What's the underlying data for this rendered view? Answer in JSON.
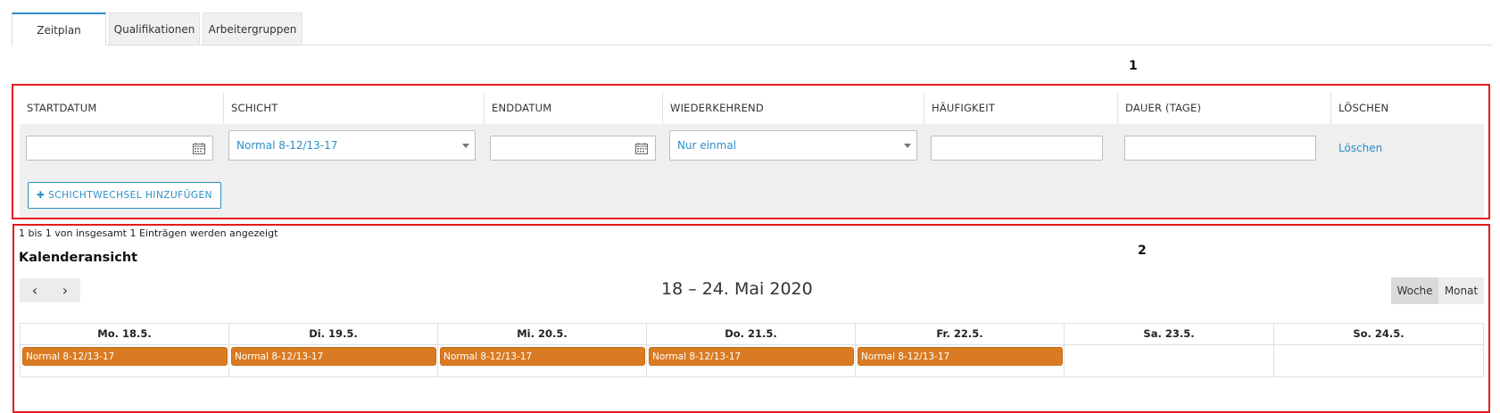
{
  "tabs": [
    {
      "label": "Zeitplan",
      "active": true
    },
    {
      "label": "Qualifikationen",
      "active": false
    },
    {
      "label": "Arbeitergruppen",
      "active": false
    }
  ],
  "annotations": {
    "box1": "1",
    "box2": "2"
  },
  "form": {
    "columns": [
      "STARTDATUM",
      "SCHICHT",
      "ENDDATUM",
      "WIEDERKEHREND",
      "HÄUFIGKEIT",
      "DAUER (TAGE)",
      "LÖSCHEN"
    ],
    "start_date_value": "",
    "shift_value": "Normal 8-12/13-17",
    "end_date_value": "",
    "recurring_value": "Nur einmal",
    "frequency_value": "",
    "duration_value": "",
    "delete_link": "Löschen",
    "add_button": "✚ SCHICHTWECHSEL HINZUFÜGEN"
  },
  "calendar": {
    "info": "1 bis 1 von insgesamt 1 Einträgen werden angezeigt",
    "title": "Kalenderansicht",
    "prev_icon": "‹",
    "next_icon": "›",
    "range": "18 – 24. Mai 2020",
    "views": [
      {
        "label": "Woche",
        "active": true
      },
      {
        "label": "Monat",
        "active": false
      }
    ],
    "days": [
      "Mo. 18.5.",
      "Di. 19.5.",
      "Mi. 20.5.",
      "Do. 21.5.",
      "Fr. 22.5.",
      "Sa. 23.5.",
      "So. 24.5."
    ],
    "events": [
      {
        "day": 0,
        "label": "Normal 8-12/13-17"
      },
      {
        "day": 1,
        "label": "Normal 8-12/13-17"
      },
      {
        "day": 2,
        "label": "Normal 8-12/13-17"
      },
      {
        "day": 3,
        "label": "Normal 8-12/13-17"
      },
      {
        "day": 4,
        "label": "Normal 8-12/13-17"
      }
    ],
    "event_color": "#d97b22"
  },
  "colors": {
    "accent": "#2a8fc6",
    "annotation": "#e31b1b"
  }
}
